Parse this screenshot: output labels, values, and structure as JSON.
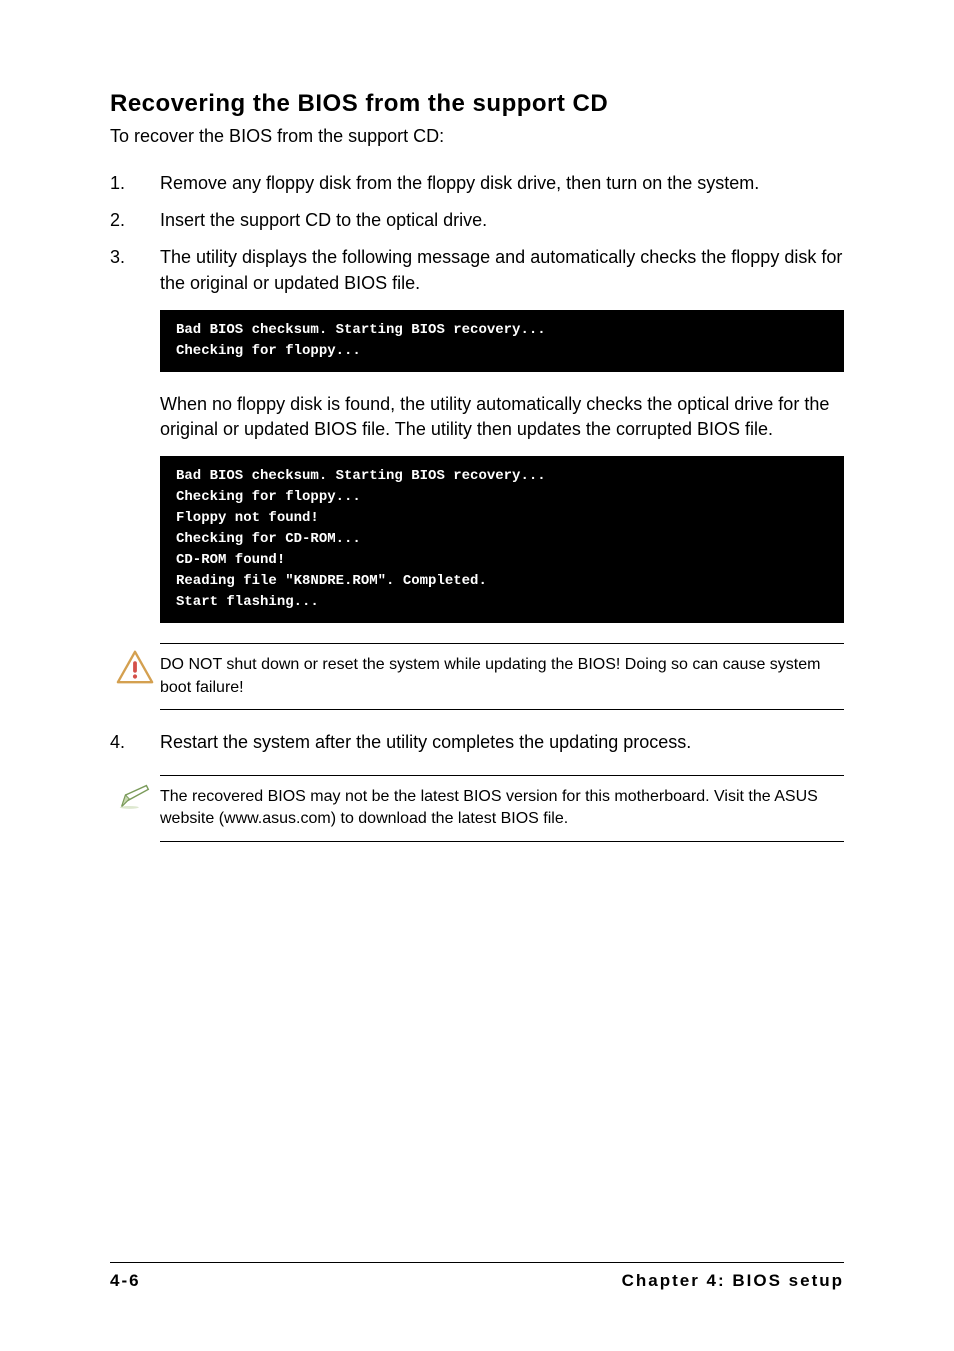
{
  "heading": "Recovering the BIOS from the support CD",
  "intro": "To recover the BIOS from the support CD:",
  "steps": {
    "s1": {
      "num": "1.",
      "text": "Remove any floppy disk from the floppy disk drive, then turn on the system."
    },
    "s2": {
      "num": "2.",
      "text": "Insert the support CD to the optical drive."
    },
    "s3": {
      "num": "3.",
      "text": "The utility displays the following message and automatically checks the floppy disk for the original or updated BIOS file."
    },
    "s4": {
      "num": "4.",
      "text": "Restart the system after the utility completes the updating process."
    }
  },
  "console1": "Bad BIOS checksum. Starting BIOS recovery...\nChecking for floppy...",
  "sub_paragraph": "When no floppy disk is found, the utility automatically checks the optical drive for the original or updated BIOS file. The utility then updates the corrupted BIOS file.",
  "console2": "Bad BIOS checksum. Starting BIOS recovery...\nChecking for floppy...\nFloppy not found!\nChecking for CD-ROM...\nCD-ROM found!\nReading file \"K8NDRE.ROM\". Completed.\nStart flashing...",
  "warning_text": "DO NOT shut down or reset the system while updating the BIOS! Doing so can cause system boot failure!",
  "note_text": "The recovered BIOS may not be the latest BIOS version for this motherboard. Visit the ASUS website (www.asus.com) to download the latest BIOS file.",
  "footer": {
    "page": "4-6",
    "chapter": "Chapter 4: BIOS setup"
  }
}
